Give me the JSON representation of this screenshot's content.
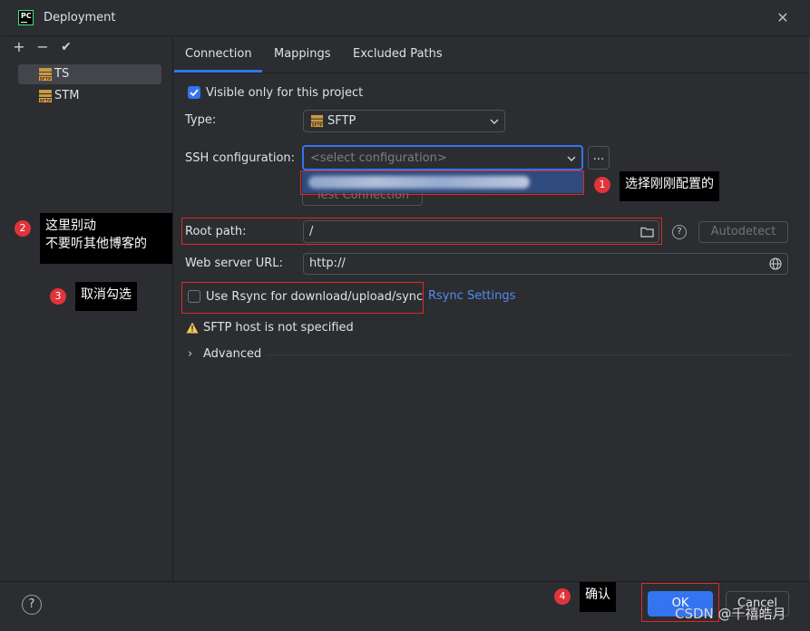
{
  "window": {
    "title": "Deployment"
  },
  "toolbar": {
    "add": "+",
    "remove": "−",
    "apply": "✔"
  },
  "servers": [
    {
      "name": "TS",
      "selected": true
    },
    {
      "name": "STM",
      "selected": false
    }
  ],
  "tabs": [
    {
      "label": "Connection",
      "active": true
    },
    {
      "label": "Mappings",
      "active": false
    },
    {
      "label": "Excluded Paths",
      "active": false
    }
  ],
  "form": {
    "visible_only_label": "Visible only for this project",
    "visible_only_checked": true,
    "type_label": "Type:",
    "type_value": "SFTP",
    "ssh_label": "SSH configuration:",
    "ssh_placeholder": "<select configuration>",
    "ssh_more_button": "...",
    "test_connection": "Test Connection",
    "root_path_label": "Root path:",
    "root_path_value": "/",
    "autodetect": "Autodetect",
    "web_url_label": "Web server URL:",
    "web_url_value": "http://",
    "rsync_label": "Use Rsync for download/upload/sync",
    "rsync_checked": false,
    "rsync_settings": "Rsync Settings",
    "warning": "SFTP host is not specified",
    "advanced": "Advanced"
  },
  "annotations": [
    {
      "num": "1",
      "text": "选择刚刚配置的"
    },
    {
      "num": "2",
      "line1": "这里别动",
      "line2": "不要听其他博客的"
    },
    {
      "num": "3",
      "text": "取消勾选"
    },
    {
      "num": "4",
      "text": "确认"
    }
  ],
  "footer": {
    "help": "?",
    "ok": "OK",
    "cancel": "Cancel"
  },
  "watermark": "CSDN @千禧皓月",
  "colors": {
    "accent": "#3574f0",
    "link": "#548af7",
    "annotation_red": "#e0272d"
  }
}
